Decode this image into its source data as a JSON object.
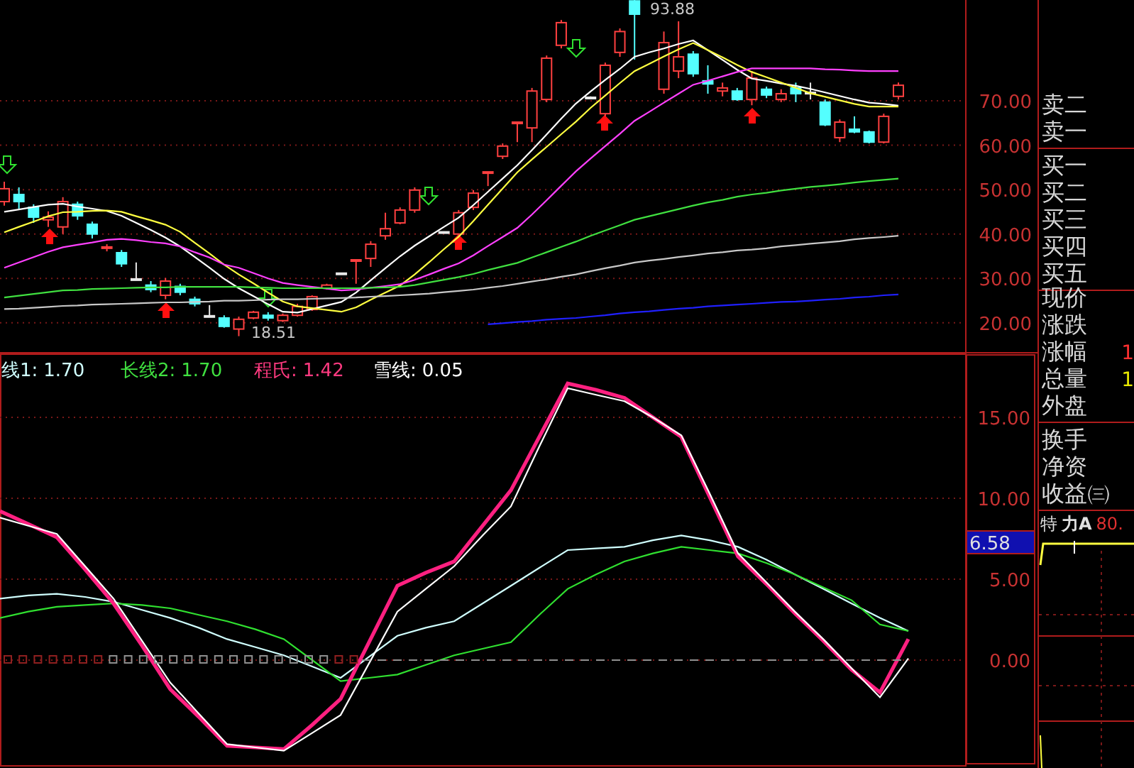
{
  "price_chart": {
    "chart_data": {
      "type": "candlestick",
      "grid": true,
      "categories": [
        null,
        null,
        null,
        null,
        null,
        null,
        null,
        null,
        null,
        null,
        null,
        null,
        null,
        null,
        null,
        null,
        null,
        null,
        null,
        null,
        null,
        null,
        null,
        null,
        null,
        null,
        null,
        null,
        null,
        null,
        null,
        null,
        null,
        null,
        null,
        null,
        null,
        null,
        null,
        null,
        null,
        null,
        null,
        null,
        null,
        null,
        null,
        null,
        null,
        null,
        null,
        null,
        null,
        null,
        null,
        null,
        null,
        null,
        null,
        null,
        null,
        null
      ],
      "ylim": [
        13.1,
        92.7
      ],
      "yticks": [
        {
          "value": 20,
          "label": "20.00"
        },
        {
          "value": 30,
          "label": "30.00"
        },
        {
          "value": 40,
          "label": "40.00"
        },
        {
          "value": 50,
          "label": "50.00"
        },
        {
          "value": 60,
          "label": "60.00"
        },
        {
          "value": 70,
          "label": "70.00"
        }
      ],
      "ohlc": [
        [
          47.3,
          51.8,
          46.4,
          50.2
        ],
        [
          48.9,
          50.5,
          45.7,
          47.3
        ],
        [
          46.0,
          46.7,
          42.5,
          43.8
        ],
        [
          43.2,
          45.1,
          41.6,
          43.8
        ],
        [
          41.6,
          48.3,
          40.0,
          47.3
        ],
        [
          46.7,
          47.3,
          43.2,
          44.1
        ],
        [
          42.2,
          42.8,
          39.0,
          40.0
        ],
        [
          36.8,
          37.7,
          36.1,
          37.1
        ],
        [
          35.8,
          36.4,
          32.6,
          33.3
        ],
        [
          29.9,
          33.6,
          29.7,
          29.9
        ],
        [
          28.5,
          29.4,
          26.9,
          27.5
        ],
        [
          26.2,
          30.1,
          25.3,
          29.4
        ],
        [
          28.2,
          28.8,
          26.2,
          26.9
        ],
        [
          25.3,
          25.9,
          23.7,
          24.3
        ],
        [
          21.6,
          24.0,
          21.4,
          21.6
        ],
        [
          21.1,
          21.7,
          18.9,
          19.2
        ],
        [
          18.6,
          21.4,
          17.0,
          20.8
        ],
        [
          21.1,
          22.7,
          20.8,
          22.4
        ],
        [
          21.7,
          22.4,
          20.5,
          21.1
        ],
        [
          20.5,
          22.1,
          20.2,
          21.7
        ],
        [
          21.7,
          24.3,
          21.4,
          23.7
        ],
        [
          23.0,
          26.2,
          22.7,
          25.9
        ],
        [
          27.8,
          28.8,
          27.5,
          28.5
        ],
        [
          31.2,
          31.3,
          31.0,
          31.2
        ],
        [
          33.9,
          34.2,
          28.8,
          34.2
        ],
        [
          34.5,
          38.4,
          32.6,
          37.7
        ],
        [
          39.6,
          44.8,
          38.7,
          41.2
        ],
        [
          42.5,
          46.0,
          42.2,
          45.4
        ],
        [
          45.4,
          50.5,
          44.8,
          49.9
        ],
        null,
        [
          40.5,
          40.6,
          40.3,
          40.5
        ],
        [
          40.0,
          45.4,
          39.3,
          44.8
        ],
        [
          46.0,
          49.9,
          45.4,
          49.2
        ],
        [
          53.7,
          54.0,
          50.8,
          54.0
        ],
        [
          57.5,
          60.4,
          56.9,
          59.8
        ],
        [
          64.9,
          65.2,
          60.7,
          65.2
        ],
        [
          63.9,
          72.9,
          60.7,
          72.2
        ],
        [
          70.3,
          80.2,
          69.7,
          79.6
        ],
        [
          82.5,
          88.2,
          81.8,
          87.6
        ],
        null,
        [
          70.8,
          71.0,
          70.6,
          70.8
        ],
        [
          67.1,
          78.6,
          66.5,
          78.0
        ],
        [
          80.9,
          86.3,
          79.9,
          85.6
        ],
        [
          92.5,
          93.9,
          79.3,
          89.5
        ],
        null,
        [
          72.6,
          85.6,
          71.6,
          83.1
        ],
        [
          76.7,
          87.9,
          75.1,
          79.9
        ],
        [
          80.5,
          81.2,
          75.4,
          76.1
        ],
        [
          74.5,
          78.0,
          71.6,
          73.8
        ],
        [
          72.2,
          74.1,
          71.0,
          72.9
        ],
        [
          72.2,
          72.9,
          70.0,
          70.3
        ],
        [
          70.3,
          76.7,
          69.0,
          75.1
        ],
        [
          72.6,
          73.2,
          70.6,
          71.3
        ],
        [
          70.3,
          72.6,
          69.7,
          71.6
        ],
        [
          72.9,
          74.1,
          69.7,
          71.6
        ],
        [
          71.9,
          74.1,
          70.3,
          71.9
        ],
        [
          69.7,
          70.3,
          64.3,
          64.6
        ],
        [
          61.7,
          65.8,
          60.7,
          65.2
        ],
        [
          63.6,
          66.5,
          62.7,
          63.0
        ],
        [
          63.0,
          63.3,
          60.4,
          60.7
        ],
        [
          60.7,
          67.1,
          60.4,
          66.5
        ],
        [
          71.0,
          74.1,
          70.3,
          73.5
        ]
      ],
      "annotations": [
        {
          "text": "93.88"
        },
        {
          "text": "18.51"
        }
      ]
    },
    "ma_chart": {
      "chart_data": {
        "type": "line",
        "ylim": [
          13.1,
          92.7
        ],
        "categories": [
          null,
          null,
          null,
          null,
          null,
          null,
          null,
          null,
          null,
          null,
          null,
          null,
          null,
          null,
          null,
          null,
          null,
          null,
          null,
          null,
          null,
          null,
          null,
          null,
          null,
          null,
          null,
          null,
          null,
          null,
          null,
          null,
          null,
          null,
          null,
          null,
          null,
          null,
          null,
          null,
          null,
          null,
          null,
          null,
          null,
          null,
          null,
          null,
          null,
          null,
          null,
          null,
          null,
          null,
          null,
          null,
          null,
          null,
          null,
          null,
          null,
          null
        ],
        "series": [
          {
            "color": "#ffffff",
            "values": [
              45.0,
              45.5,
              46.1,
              46.6,
              46.8,
              46.2,
              45.7,
              45.2,
              44.1,
              42.5,
              40.9,
              39.2,
              37.2,
              34.8,
              32.4,
              29.9,
              27.8,
              26.0,
              24.2,
              22.5,
              22.3,
              23.1,
              23.9,
              24.7,
              26.8,
              29.6,
              32.3,
              35.0,
              37.4,
              39.5,
              41.6,
              43.7,
              46.5,
              49.5,
              52.5,
              55.5,
              58.9,
              62.4,
              66.0,
              69.4,
              72.1,
              74.7,
              77.2,
              79.9,
              80.9,
              81.8,
              82.8,
              83.6,
              81.4,
              79.2,
              77.0,
              75.0,
              74.5,
              73.9,
              73.4,
              72.7,
              71.9,
              71.1,
              70.3,
              69.6,
              69.3,
              68.9
            ]
          },
          {
            "color": "#ffff40",
            "values": [
              40.4,
              41.6,
              42.8,
              44.0,
              44.9,
              45.0,
              45.2,
              45.3,
              45.0,
              44.0,
              43.1,
              42.1,
              40.5,
              38.0,
              35.6,
              33.1,
              30.9,
              28.9,
              26.8,
              24.8,
              23.7,
              23.3,
              22.9,
              22.5,
              23.5,
              25.2,
              26.8,
              28.4,
              30.9,
              33.7,
              36.6,
              39.4,
              42.9,
              46.6,
              50.2,
              53.9,
              56.8,
              59.6,
              62.5,
              65.3,
              68.4,
              71.2,
              74.0,
              76.7,
              78.3,
              80.0,
              81.6,
              83.0,
              81.4,
              79.8,
              78.1,
              76.5,
              75.3,
              74.1,
              72.9,
              71.7,
              70.9,
              70.1,
              69.3,
              68.7,
              68.7,
              68.7
            ]
          },
          {
            "color": "#ff40ff",
            "values": [
              32.4,
              33.6,
              34.8,
              36.0,
              37.0,
              37.6,
              38.1,
              38.7,
              38.9,
              38.6,
              38.2,
              37.9,
              37.2,
              35.9,
              34.7,
              33.1,
              32.4,
              31.2,
              30.0,
              29.0,
              28.5,
              28.1,
              27.7,
              27.3,
              27.5,
              27.9,
              28.3,
              28.7,
              29.7,
              30.9,
              32.2,
              33.4,
              35.2,
              37.3,
              39.3,
              41.4,
              44.4,
              47.6,
              50.9,
              54.1,
              57.0,
              59.8,
              62.6,
              65.5,
              67.5,
              69.6,
              71.6,
              73.6,
              74.5,
              75.5,
              76.5,
              77.3,
              77.3,
              77.3,
              77.3,
              77.3,
              77.1,
              77.0,
              76.8,
              76.7,
              76.7,
              76.7
            ]
          },
          {
            "color": "#40e040",
            "values": [
              25.7,
              26.1,
              26.5,
              26.9,
              27.3,
              27.4,
              27.6,
              27.7,
              27.8,
              27.9,
              28.0,
              28.0,
              28.1,
              28.1,
              28.1,
              28.1,
              28.1,
              28.0,
              27.9,
              27.8,
              27.8,
              27.8,
              27.8,
              27.8,
              27.8,
              27.9,
              28.0,
              28.1,
              28.5,
              29.1,
              29.7,
              30.3,
              31.0,
              31.9,
              32.7,
              33.5,
              34.7,
              35.9,
              37.1,
              38.3,
              39.6,
              40.8,
              42.0,
              43.2,
              44.0,
              44.8,
              45.6,
              46.4,
              47.1,
              47.7,
              48.4,
              48.9,
              49.3,
              49.8,
              50.2,
              50.6,
              50.9,
              51.2,
              51.6,
              51.9,
              52.2,
              52.5
            ]
          },
          {
            "color": "#c8c8c8",
            "values": [
              23.1,
              23.2,
              23.4,
              23.6,
              23.8,
              23.9,
              24.1,
              24.2,
              24.3,
              24.4,
              24.5,
              24.6,
              24.6,
              24.7,
              24.8,
              25.0,
              25.0,
              25.1,
              25.2,
              25.3,
              25.3,
              25.4,
              25.5,
              25.6,
              25.7,
              25.9,
              26.0,
              26.2,
              26.4,
              26.6,
              26.9,
              27.2,
              27.5,
              27.9,
              28.3,
              28.8,
              29.3,
              29.8,
              30.4,
              30.9,
              31.6,
              32.3,
              32.9,
              33.6,
              34.0,
              34.4,
              34.8,
              35.2,
              35.6,
              35.9,
              36.3,
              36.5,
              36.8,
              37.2,
              37.5,
              37.8,
              38.1,
              38.4,
              38.8,
              39.1,
              39.3,
              39.6
            ]
          },
          {
            "color": "#2020ff",
            "values": [
              null,
              null,
              null,
              null,
              null,
              null,
              null,
              null,
              null,
              null,
              null,
              null,
              null,
              null,
              null,
              null,
              null,
              null,
              null,
              null,
              null,
              null,
              null,
              null,
              null,
              null,
              null,
              null,
              null,
              null,
              null,
              null,
              null,
              19.7,
              19.9,
              20.2,
              20.4,
              20.7,
              20.9,
              21.1,
              21.4,
              21.7,
              22.1,
              22.4,
              22.6,
              22.9,
              23.2,
              23.4,
              23.7,
              23.9,
              24.1,
              24.3,
              24.5,
              24.7,
              24.8,
              25.0,
              25.2,
              25.4,
              25.7,
              25.9,
              26.2,
              26.4
            ]
          }
        ]
      }
    }
  },
  "indicator_chart": {
    "legend": [
      {
        "label": "线1:",
        "value": "1.70",
        "color": "#d0ffff"
      },
      {
        "label": "长线2:",
        "value": "1.70",
        "color": "#40e040"
      },
      {
        "label": "程氏:",
        "value": "1.42",
        "color": "#ff3a80"
      },
      {
        "label": "雪线:",
        "value": "0.05",
        "color": "#ffffff"
      }
    ],
    "current_value": "6.58",
    "chart_data": {
      "type": "line",
      "grid": true,
      "categories": [
        null,
        null,
        null,
        null,
        null,
        null,
        null,
        null,
        null,
        null,
        null,
        null,
        null,
        null,
        null,
        null,
        null,
        null,
        null,
        null,
        null,
        null,
        null,
        null,
        null,
        null,
        null,
        null,
        null,
        null,
        null,
        null,
        null
      ],
      "ylim": [
        -6.67,
        18.95
      ],
      "yticks": [
        {
          "value": 0,
          "label": "0.00"
        },
        {
          "value": 5,
          "label": "5.00"
        },
        {
          "value": 10,
          "label": "10.00"
        },
        {
          "value": 15,
          "label": "15.00"
        }
      ],
      "series": [
        {
          "color": "#d0ffff",
          "values": [
            3.8,
            4.0,
            4.1,
            3.9,
            3.6,
            3.1,
            2.6,
            2.0,
            1.3,
            0.8,
            0.3,
            -0.4,
            -1.1,
            0.2,
            1.5,
            2.0,
            2.4,
            3.5,
            4.6,
            5.7,
            6.8,
            6.9,
            7.0,
            7.4,
            7.7,
            7.4,
            7.0,
            6.2,
            5.3,
            4.4,
            3.5,
            2.6,
            1.8
          ]
        },
        {
          "color": "#30e030",
          "values": [
            2.6,
            3.0,
            3.3,
            3.4,
            3.5,
            3.4,
            3.2,
            2.8,
            2.4,
            1.9,
            1.3,
            0,
            -1.3,
            -1.1,
            -0.9,
            -0.3,
            0.3,
            0.7,
            1.1,
            2.8,
            4.4,
            5.3,
            6.1,
            6.6,
            7.0,
            6.8,
            6.6,
            6.0,
            5.3,
            4.5,
            3.7,
            2.2,
            1.8
          ]
        },
        {
          "color": "#ff2080",
          "values": [
            9.2,
            8.4,
            7.6,
            5.6,
            3.5,
            0.9,
            -1.8,
            -3.5,
            -5.3,
            -5.4,
            -5.5,
            -4.0,
            -2.4,
            1.1,
            4.6,
            5.4,
            6.1,
            8.3,
            10.5,
            13.8,
            17.1,
            16.7,
            16.2,
            15.0,
            13.8,
            10.1,
            6.4,
            4.7,
            2.9,
            1.2,
            -0.6,
            -2.0,
            1.3
          ]
        },
        {
          "color": "#ffffff",
          "values": [
            8.8,
            8.3,
            7.8,
            5.8,
            3.8,
            1.2,
            -1.4,
            -3.3,
            -5.2,
            -5.4,
            -5.6,
            -4.5,
            -3.4,
            -0.2,
            3.0,
            4.4,
            5.8,
            7.7,
            9.5,
            13.2,
            16.8,
            16.4,
            16.0,
            15.0,
            13.9,
            10.3,
            6.6,
            4.8,
            3.0,
            1.3,
            -0.5,
            -2.3,
            0.1
          ]
        }
      ]
    }
  },
  "quote_panel": {
    "groups": [
      [
        {
          "label": "卖二"
        },
        {
          "label": "卖一"
        }
      ],
      [
        {
          "label": "买一"
        },
        {
          "label": "买二"
        },
        {
          "label": "买三"
        },
        {
          "label": "买四"
        },
        {
          "label": "买五"
        }
      ],
      [
        {
          "label": "现价"
        },
        {
          "label": "涨跌"
        },
        {
          "label": "涨幅",
          "value": "1",
          "color": "#ff3030"
        },
        {
          "label": "总量",
          "value": "1",
          "color": "#e8e800"
        },
        {
          "label": "外盘"
        }
      ],
      [
        {
          "label": "换手"
        },
        {
          "label": "净资"
        },
        {
          "label": "收益㈢"
        }
      ]
    ],
    "indicator_row": {
      "name": "特",
      "line": "力A",
      "value": "80."
    }
  }
}
